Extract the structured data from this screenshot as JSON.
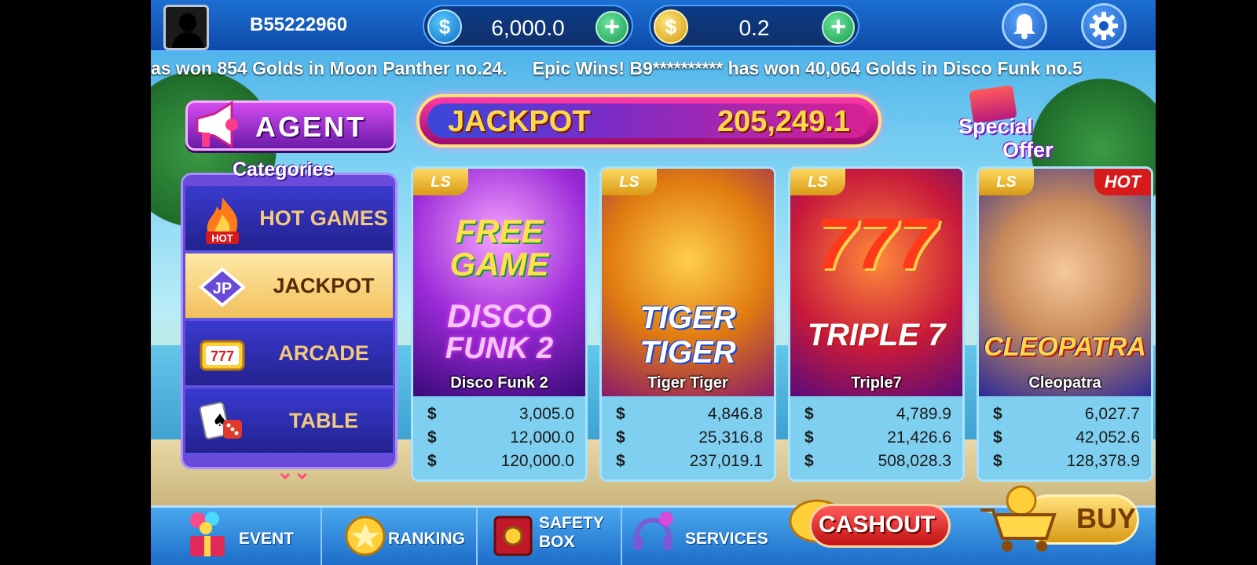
{
  "header": {
    "username": "B55222960",
    "balance_primary": "6,000.0",
    "balance_secondary": "0.2",
    "currency_symbol": "$"
  },
  "ticker": {
    "text": "as won 854 Golds in Moon Panther no.24.     Epic Wins! B9********** has won 40,064 Golds in Disco Funk no.5"
  },
  "agent": {
    "label": "AGENT"
  },
  "jackpot": {
    "label": "JACKPOT",
    "value": "205,249.1"
  },
  "special_offer": {
    "line1": "Special",
    "line2": "Offer"
  },
  "categories": {
    "title": "Categories",
    "items": [
      {
        "label": "HOT GAMES",
        "badge": "HOT"
      },
      {
        "label": "JACKPOT",
        "badge": "JP"
      },
      {
        "label": "ARCADE",
        "badge": "777"
      },
      {
        "label": "TABLE"
      }
    ],
    "more": "⌄⌄"
  },
  "games": [
    {
      "provider": "LS",
      "name": "Disco Funk 2",
      "art_line1": "FREE",
      "art_line2": "GAME",
      "art_line3": "DISCO",
      "art_line4": "FUNK 2",
      "pots": [
        "3,005.0",
        "12,000.0",
        "120,000.0"
      ]
    },
    {
      "provider": "LS",
      "name": "Tiger Tiger",
      "art_line1": "TIGER",
      "art_line2": "TIGER",
      "pots": [
        "4,846.8",
        "25,316.8",
        "237,019.1"
      ]
    },
    {
      "provider": "LS",
      "name": "Triple7",
      "art_line1": "777",
      "art_line2": "TRIPLE 7",
      "pots": [
        "4,789.9",
        "21,426.6",
        "508,028.3"
      ]
    },
    {
      "provider": "LS",
      "name": "Cleopatra",
      "art_line1": "CLEOPATRA",
      "badge": "HOT",
      "pots": [
        "6,027.7",
        "42,052.6",
        "128,378.9"
      ]
    }
  ],
  "bottom": {
    "event": "EVENT",
    "ranking": "RANKING",
    "safety_box_1": "SAFETY",
    "safety_box_2": "BOX",
    "services": "SERVICES",
    "cashout": "CASHOUT",
    "buy": "BUY"
  },
  "colors": {
    "accent_blue": "#1c6fd3",
    "jackpot_pink": "#ff3aa8",
    "category_purple": "#6a4ad8",
    "gold": "#ffd84a"
  }
}
